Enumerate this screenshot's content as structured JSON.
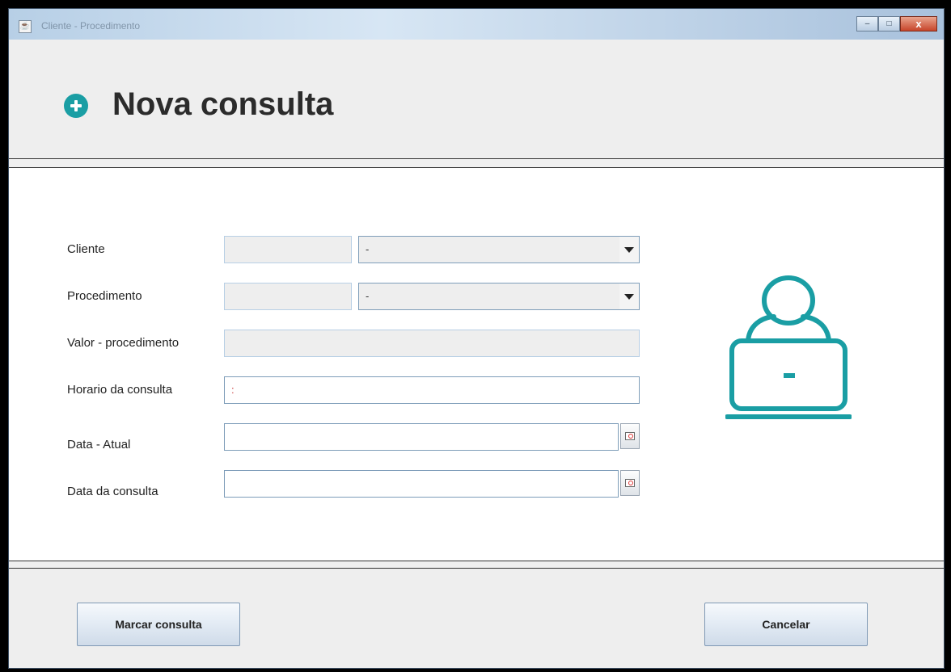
{
  "window": {
    "title": "Cliente - Procedimento",
    "app_icon": "java-icon",
    "controls": {
      "minimize": "–",
      "maximize": "□",
      "close": "x"
    }
  },
  "header": {
    "icon": "plus-circle-icon",
    "title": "Nova consulta"
  },
  "form": {
    "cliente": {
      "label": "Cliente",
      "id_value": "",
      "combo_value": "-"
    },
    "procedimento": {
      "label": "Procedimento",
      "id_value": "",
      "combo_value": "-"
    },
    "valor": {
      "label": "Valor - procedimento",
      "value": ""
    },
    "horario": {
      "label": "Horario da consulta",
      "value": ":"
    },
    "data_atual": {
      "label": "Data - Atual",
      "value": ""
    },
    "data_consulta": {
      "label": "Data da consulta",
      "value": ""
    }
  },
  "illustration": {
    "icon": "user-computer-icon",
    "color": "#1a9ea4"
  },
  "actions": {
    "marcar": "Marcar consulta",
    "cancelar": "Cancelar"
  },
  "colors": {
    "accent": "#1a9ea4"
  }
}
